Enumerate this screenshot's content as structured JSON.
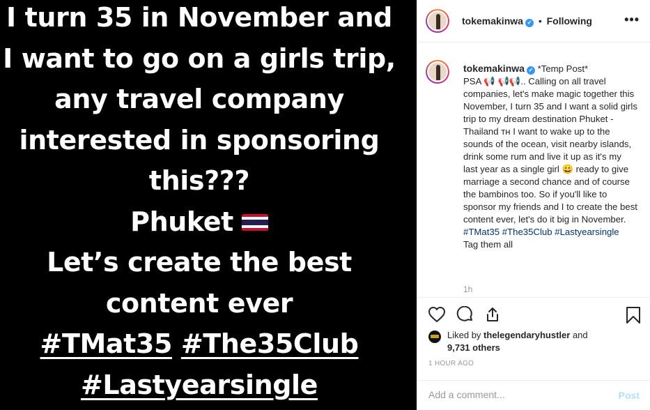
{
  "story": {
    "lines": [
      "I turn 35 in November and",
      "I want to go on a girls trip,",
      "any travel company",
      "interested in sponsoring",
      "this???",
      "Phuket",
      "Let’s create the best",
      "content ever"
    ],
    "tag_line_1": [
      "#TMat35",
      "#The35Club"
    ],
    "tag_line_2": "#Lastyearsingle",
    "flag_icon": "thailand-flag-icon"
  },
  "header": {
    "username": "tokemakinwa",
    "separator": "•",
    "follow_status": "Following",
    "more_label": "•••"
  },
  "caption": {
    "username": "tokemakinwa",
    "intro": "*Temp Post*",
    "psa_prefix": "PSA",
    "megaphone_icons": [
      "📢",
      "📢",
      "📢"
    ],
    "body_1": ".. Calling on all travel companies, let's make magic together this November, I turn 35 and I want a solid girls trip to my dream destination Phuket - Thailand",
    "th_mark": "ᴛʜ",
    "body_2": "I want to wake up to the sounds of the ocean, visit nearby islands, drink some rum and live it up as it's my last year as a single girl",
    "emoji": "😀",
    "body_3": "ready to give marriage a second chance and of course the bambinos too. So if you'll like to sponsor my friends and I to create the best content ever, let's do it big in November.",
    "hashtags": [
      "#TMat35",
      "#The35Club",
      "#Lastyearsingle"
    ],
    "closing": "Tag them all",
    "time_ago": "1h"
  },
  "actions": {
    "icons": [
      "heart-icon",
      "comment-icon",
      "share-icon",
      "bookmark-icon"
    ]
  },
  "likes": {
    "prefix": "Liked by",
    "user": "thelegendaryhustler",
    "and": "and",
    "others": "9,731 others"
  },
  "timestamp": "1 HOUR AGO",
  "comment": {
    "placeholder": "Add a comment...",
    "post_label": "Post"
  },
  "colors": {
    "link": "#003569",
    "verified": "#3897f0",
    "post_disabled": "#b2dffc",
    "muted": "#999999"
  }
}
